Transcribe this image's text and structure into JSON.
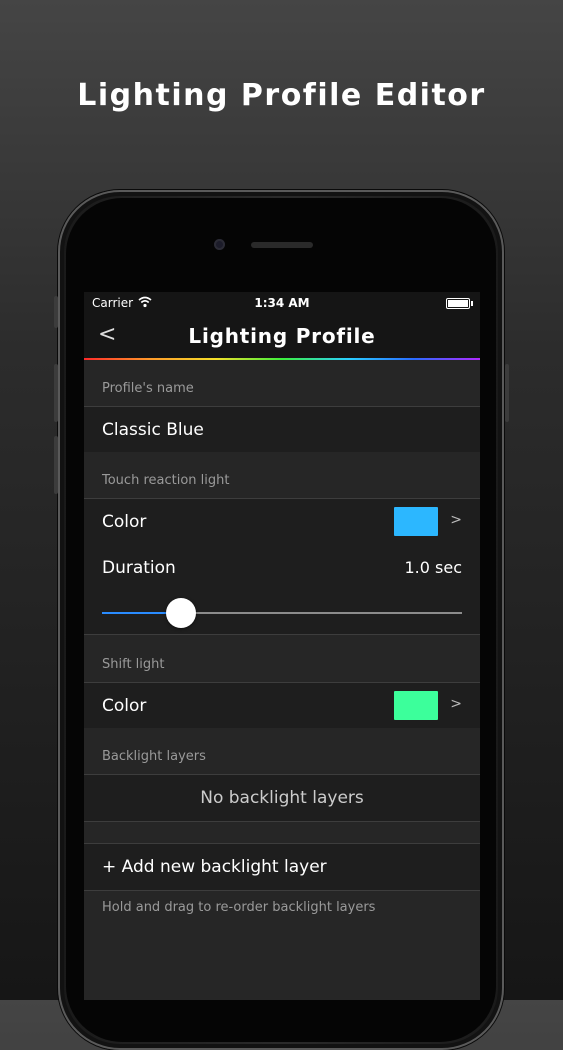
{
  "headline": "Lighting Profile Editor",
  "status_bar": {
    "carrier": "Carrier",
    "time": "1:34 AM",
    "battery_level": 1.0
  },
  "nav": {
    "back_label": "<",
    "title": "Lighting Profile"
  },
  "profile_name": {
    "header": "Profile's name",
    "value": "Classic Blue"
  },
  "touch_reaction": {
    "header": "Touch reaction light",
    "color_label": "Color",
    "color": "#2cb7ff",
    "chevron": ">",
    "duration_label": "Duration",
    "duration_value": "1.0 sec",
    "duration_fraction": 0.22
  },
  "shift_light": {
    "header": "Shift light",
    "color_label": "Color",
    "color": "#3cff9b",
    "chevron": ">"
  },
  "backlight": {
    "header": "Backlight layers",
    "empty_text": "No backlight layers",
    "add_label": "+ Add new backlight layer",
    "hint": "Hold and drag to re-order backlight layers"
  },
  "icons": {
    "wifi": "wifi-icon",
    "battery": "battery-icon",
    "back": "chevron-left-icon"
  }
}
